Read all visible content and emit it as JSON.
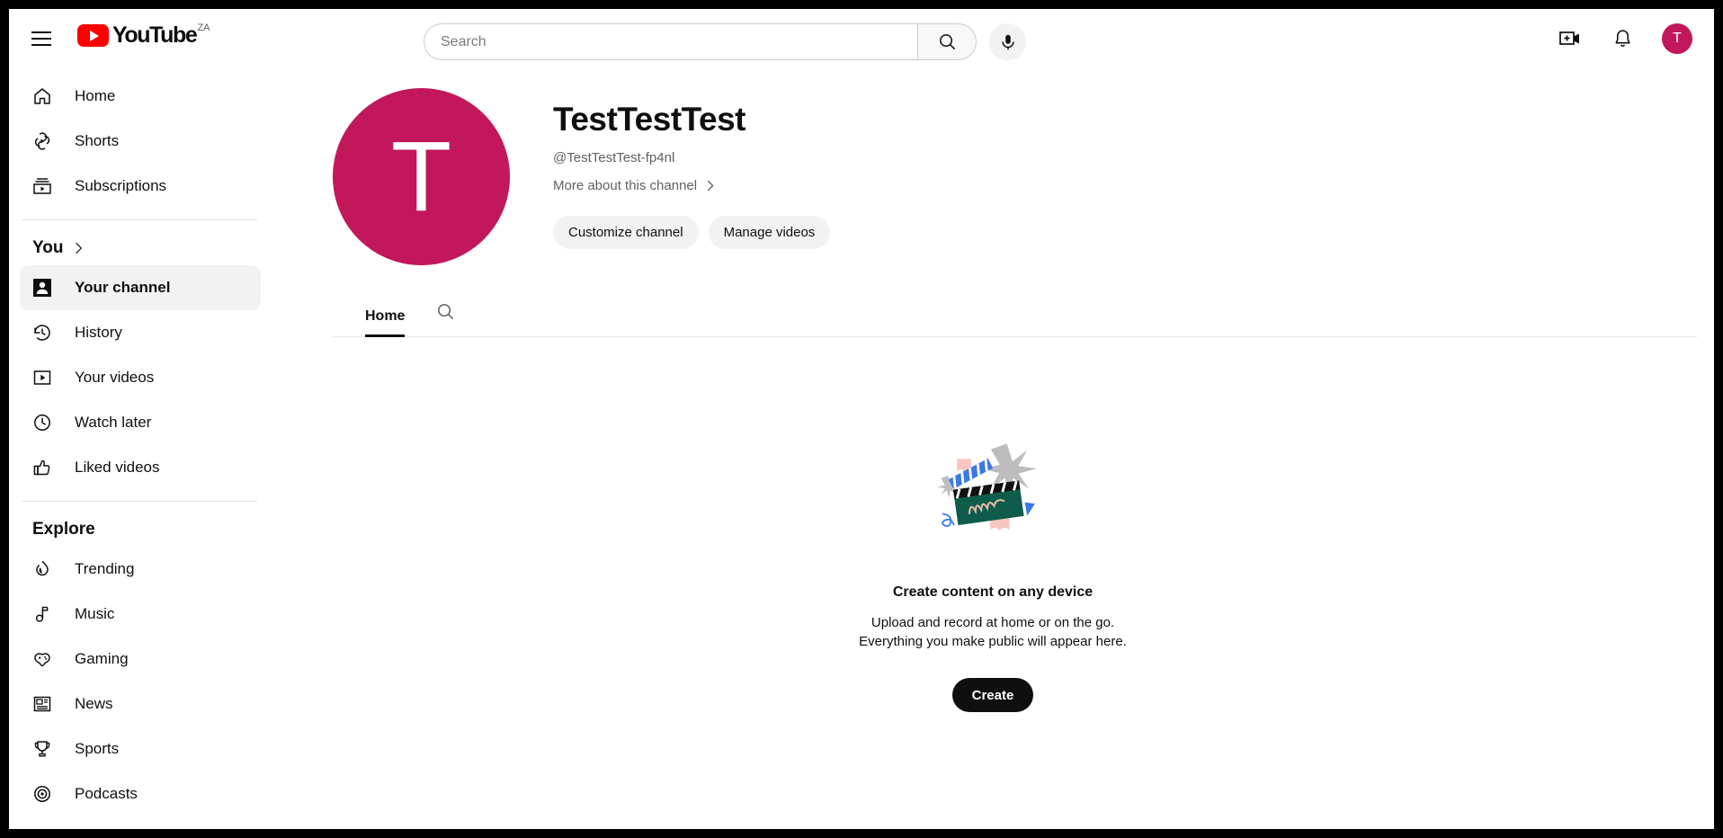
{
  "topbar": {
    "menu_icon": "hamburger-icon",
    "logo_text": "YouTube",
    "logo_country": "ZA",
    "search_placeholder": "Search",
    "search_value": "",
    "search_icon": "search-icon",
    "mic_icon": "microphone-icon",
    "create_icon": "create-video-icon",
    "notifications_icon": "bell-icon",
    "avatar_initial": "T"
  },
  "sidebar": {
    "primary": [
      {
        "label": "Home",
        "icon": "home-icon",
        "active": false
      },
      {
        "label": "Shorts",
        "icon": "shorts-icon",
        "active": false
      },
      {
        "label": "Subscriptions",
        "icon": "subscriptions-icon",
        "active": false
      }
    ],
    "you_header": "You",
    "you_chevron": "chevron-right-icon",
    "you": [
      {
        "label": "Your channel",
        "icon": "person-icon",
        "active": true
      },
      {
        "label": "History",
        "icon": "history-icon",
        "active": false
      },
      {
        "label": "Your videos",
        "icon": "video-icon",
        "active": false
      },
      {
        "label": "Watch later",
        "icon": "clock-icon",
        "active": false
      },
      {
        "label": "Liked videos",
        "icon": "thumbs-up-icon",
        "active": false
      }
    ],
    "explore_header": "Explore",
    "explore": [
      {
        "label": "Trending",
        "icon": "trending-icon",
        "active": false
      },
      {
        "label": "Music",
        "icon": "music-note-icon",
        "active": false
      },
      {
        "label": "Gaming",
        "icon": "gaming-icon",
        "active": false
      },
      {
        "label": "News",
        "icon": "news-icon",
        "active": false
      },
      {
        "label": "Sports",
        "icon": "trophy-icon",
        "active": false
      },
      {
        "label": "Podcasts",
        "icon": "podcast-icon",
        "active": false
      }
    ]
  },
  "channel": {
    "avatar_initial": "T",
    "avatar_color": "#c2185b",
    "name": "TestTestTest",
    "handle": "@TestTestTest-fp4nl",
    "more_link": "More about this channel",
    "more_chevron": "chevron-right-icon",
    "buttons": [
      {
        "label": "Customize channel"
      },
      {
        "label": "Manage videos"
      }
    ]
  },
  "tabs": [
    {
      "label": "Home",
      "active": true
    }
  ],
  "tab_search_icon": "search-icon",
  "empty_state": {
    "illustration": "clapperboard-illustration",
    "title": "Create content on any device",
    "line1": "Upload and record at home or on the go.",
    "line2": "Everything you make public will appear here.",
    "button": "Create"
  }
}
